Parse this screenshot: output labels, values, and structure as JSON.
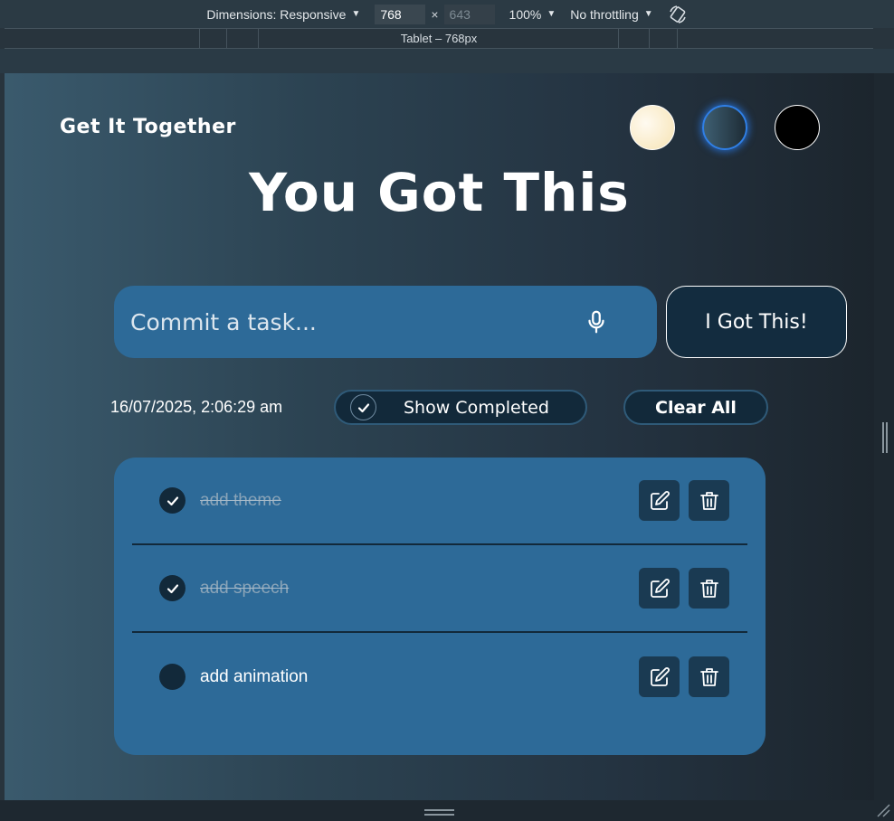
{
  "devtools": {
    "dimensions_label": "Dimensions: Responsive",
    "width_value": "768",
    "height_value": "643",
    "times": "×",
    "zoom": "100%",
    "throttling": "No throttling",
    "ruler_label": "Tablet – 768px"
  },
  "app": {
    "title": "Get It Together",
    "hero": "You Got This",
    "themes": [
      "light",
      "blue",
      "dark"
    ],
    "colors": {
      "panel": "#2d6a98",
      "dark_navy": "#12293a",
      "accent_glow": "#2f7fe6"
    }
  },
  "input": {
    "placeholder": "Commit a task...",
    "value": "",
    "submit_label": "I Got This!"
  },
  "controls": {
    "datetime": "16/07/2025, 2:06:29 am",
    "show_completed_label": "Show Completed",
    "show_completed_checked": true,
    "clear_all_label": "Clear All"
  },
  "tasks": [
    {
      "text": "add theme",
      "completed": true
    },
    {
      "text": "add speech",
      "completed": true
    },
    {
      "text": "add animation",
      "completed": false
    }
  ]
}
